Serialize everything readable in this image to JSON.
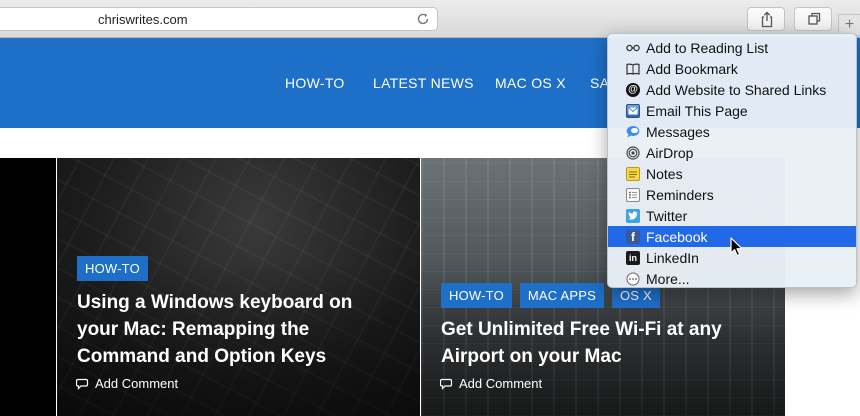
{
  "browser": {
    "address": "chriswrites.com",
    "plus_label": "+"
  },
  "site": {
    "nav": [
      "HOW-TO",
      "LATEST NEWS",
      "MAC OS X",
      "SA"
    ]
  },
  "cards": [
    {
      "tags": [
        "HOW-TO"
      ],
      "title_lines": [
        "Using a Windows keyboard on",
        "your Mac: Remapping the",
        "Command and Option Keys"
      ],
      "comment": "Add Comment"
    },
    {
      "tags": [
        "HOW-TO",
        "MAC APPS",
        "OS X"
      ],
      "title_lines": [
        "Get Unlimited Free Wi-Fi at any",
        "Airport on your Mac"
      ],
      "comment": "Add Comment"
    }
  ],
  "share_menu": {
    "items": [
      {
        "label": "Add to Reading List",
        "icon": "reading-list-icon"
      },
      {
        "label": "Add Bookmark",
        "icon": "bookmark-icon"
      },
      {
        "label": "Add Website to Shared Links",
        "icon": "shared-links-icon"
      },
      {
        "label": "Email This Page",
        "icon": "email-icon"
      },
      {
        "label": "Messages",
        "icon": "messages-icon"
      },
      {
        "label": "AirDrop",
        "icon": "airdrop-icon"
      },
      {
        "label": "Notes",
        "icon": "notes-icon"
      },
      {
        "label": "Reminders",
        "icon": "reminders-icon"
      },
      {
        "label": "Twitter",
        "icon": "twitter-icon"
      },
      {
        "label": "Facebook",
        "icon": "facebook-icon",
        "selected": true
      },
      {
        "label": "LinkedIn",
        "icon": "linkedin-icon"
      },
      {
        "label": "More...",
        "icon": "more-icon"
      }
    ]
  },
  "colors": {
    "brand_blue": "#1e6fc8",
    "menu_highlight": "#2169e6"
  }
}
